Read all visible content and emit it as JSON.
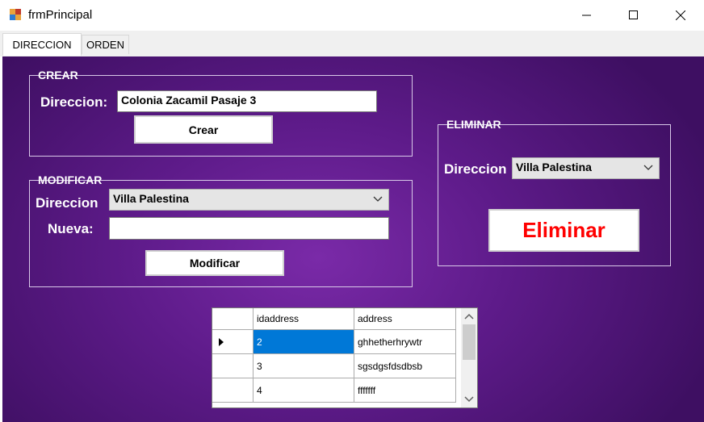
{
  "window": {
    "title": "frmPrincipal"
  },
  "tabs": [
    {
      "label": "DIRECCION",
      "active": true
    },
    {
      "label": "ORDEN",
      "active": false
    }
  ],
  "crear": {
    "legend": "CREAR",
    "direccion_label": "Direccion:",
    "direccion_value": "Colonia Zacamil Pasaje 3",
    "button_label": "Crear"
  },
  "modificar": {
    "legend": "MODIFICAR",
    "direccion_label": "Direccion",
    "direccion_selected": "Villa Palestina",
    "nueva_label": "Nueva:",
    "nueva_value": "",
    "button_label": "Modificar"
  },
  "eliminar": {
    "legend": "ELIMINAR",
    "direccion_label": "Direccion",
    "direccion_selected": "Villa Palestina",
    "button_label": "Eliminar",
    "button_color": "#ff0000"
  },
  "grid": {
    "columns": [
      "idaddress",
      "address"
    ],
    "rows": [
      {
        "idaddress": "2",
        "address": "ghhetherhrywtr",
        "selected": true
      },
      {
        "idaddress": "3",
        "address": "sgsdgsfdsdbsb",
        "selected": false
      },
      {
        "idaddress": "4",
        "address": "fffffff",
        "selected": false
      }
    ]
  },
  "colors": {
    "panel": "#5e1b8a",
    "selection": "#0078d7"
  }
}
